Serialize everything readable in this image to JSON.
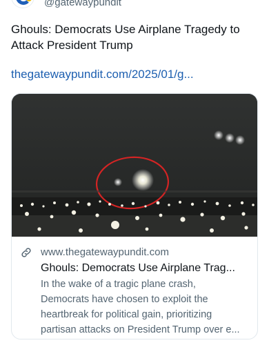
{
  "post": {
    "handle": "@gatewaypundit",
    "text_line1": "Ghouls: Democrats Use Airplane Tragedy to",
    "text_line2": "Attack President Trump",
    "link_text": "thegatewaypundit.com/2025/01/g..."
  },
  "card": {
    "domain": "www.thegatewaypundit.com",
    "title": "Ghouls: Democrats Use Airplane Trag...",
    "description_lines": [
      "In the wake of a tragic plane crash,",
      "Democrats have chosen to exploit the",
      "heartbreak for political gain, prioritizing",
      "partisan attacks on President Trump over e..."
    ],
    "image_subject": "night-sky-aircraft-lights-with-red-circle"
  },
  "colors": {
    "link": "#1d5fb0",
    "muted": "#536471",
    "circle": "#d42424"
  },
  "icons": {
    "card_link_icon": "link-icon",
    "avatar_logo": "gateway-pundit-logo"
  }
}
